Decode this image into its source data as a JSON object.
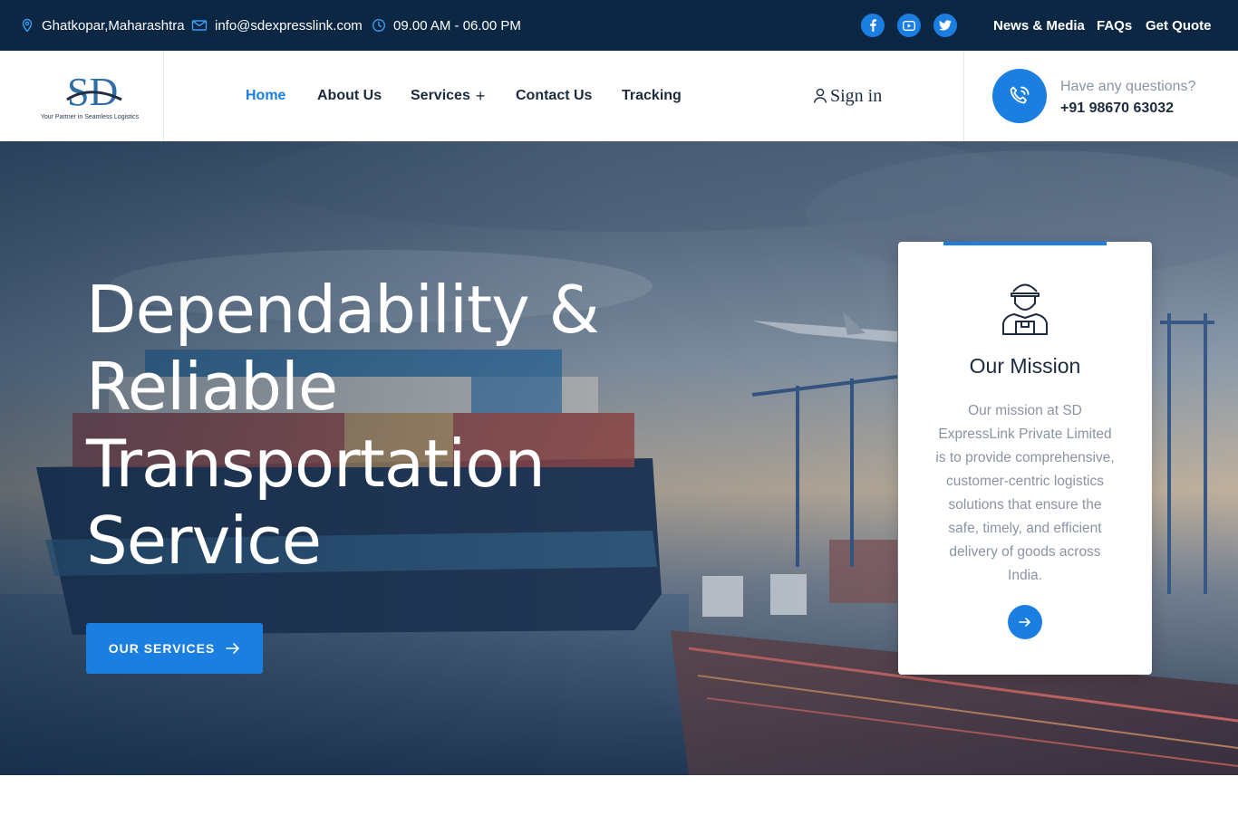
{
  "topbar": {
    "location": "Ghatkopar,Maharashtra",
    "email": "info@sdexpresslink.com",
    "hours": "09.00 AM - 06.00 PM",
    "social": [
      "facebook-icon",
      "youtube-icon",
      "twitter-icon"
    ],
    "links": [
      "News & Media",
      "FAQs",
      "Get Quote"
    ]
  },
  "header": {
    "logo_text": "SD",
    "logo_tagline": "Your Partner in Seamless Logistics",
    "nav": [
      "Home",
      "About Us",
      "Services",
      "Contact Us",
      "Tracking"
    ],
    "active_nav": "Home",
    "signin_label": "Sign in",
    "contact_label": "Have any questions?",
    "contact_phone": "+91 98670 63032"
  },
  "hero": {
    "title_lines": [
      "Dependability &",
      "Reliable",
      "Transportation",
      "Service"
    ],
    "cta_label": "OUR SERVICES"
  },
  "mission": {
    "icon": "delivery-man-icon",
    "title": "Our Mission",
    "text": "Our mission at SD ExpressLink Private Limited is to provide comprehensive, customer-centric logistics solutions that ensure the safe, timely, and efficient delivery of goods across India."
  },
  "colors": {
    "topbar_bg": "#0c2744",
    "accent": "#1a7fe0",
    "text_dark": "#1c2b3d",
    "text_muted": "#8a94a3"
  }
}
